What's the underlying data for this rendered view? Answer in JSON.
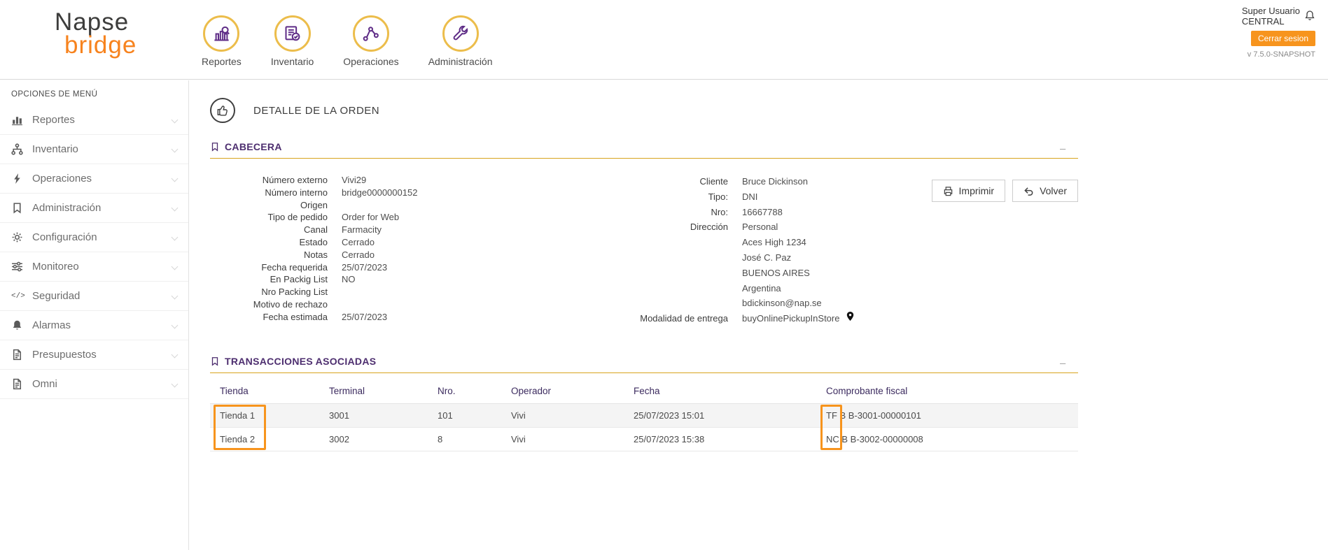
{
  "header": {
    "logo": {
      "line1": "Napse",
      "line2": "bridge"
    },
    "nav": [
      {
        "label": "Reportes",
        "icon": "reports-chart-icon"
      },
      {
        "label": "Inventario",
        "icon": "inventory-clipboard-icon"
      },
      {
        "label": "Operaciones",
        "icon": "operations-network-icon"
      },
      {
        "label": "Administración",
        "icon": "admin-wrench-icon"
      }
    ],
    "user": {
      "name": "Super Usuario",
      "scope": "CENTRAL",
      "logout_label": "Cerrar sesion",
      "version": "v 7.5.0-SNAPSHOT"
    }
  },
  "sidebar": {
    "title": "OPCIONES DE MENÚ",
    "items": [
      {
        "label": "Reportes",
        "icon": "bar-chart-icon"
      },
      {
        "label": "Inventario",
        "icon": "sitemap-icon"
      },
      {
        "label": "Operaciones",
        "icon": "bolt-icon"
      },
      {
        "label": "Administración",
        "icon": "bookmark-icon"
      },
      {
        "label": "Configuración",
        "icon": "gear-icon"
      },
      {
        "label": "Monitoreo",
        "icon": "sliders-icon"
      },
      {
        "label": "Seguridad",
        "icon": "code-icon"
      },
      {
        "label": "Alarmas",
        "icon": "bell-icon"
      },
      {
        "label": "Presupuestos",
        "icon": "document-icon"
      },
      {
        "label": "Omni",
        "icon": "document-icon"
      }
    ]
  },
  "page": {
    "title": "DETALLE DE LA ORDEN"
  },
  "cabecera": {
    "title": "CABECERA",
    "collapse_glyph": "_",
    "fields_left": [
      {
        "label": "Número externo",
        "value": "Vivi29"
      },
      {
        "label": "Número interno",
        "value": "bridge0000000152"
      },
      {
        "label": "Origen",
        "value": ""
      },
      {
        "label": "Tipo de pedido",
        "value": "Order for Web"
      },
      {
        "label": "Canal",
        "value": "Farmacity"
      },
      {
        "label": "Estado",
        "value": "Cerrado"
      },
      {
        "label": "Notas",
        "value": "Cerrado"
      },
      {
        "label": "Fecha requerida",
        "value": "25/07/2023"
      },
      {
        "label": "En Packig List",
        "value": "NO"
      },
      {
        "label": "Nro Packing List",
        "value": ""
      },
      {
        "label": "Motivo de rechazo",
        "value": ""
      },
      {
        "label": "Fecha estimada",
        "value": "25/07/2023"
      }
    ],
    "fields_right": [
      {
        "label": "Cliente",
        "value": "Bruce Dickinson"
      },
      {
        "label": "Tipo:",
        "value": "DNI"
      },
      {
        "label": "Nro:",
        "value": "16667788"
      },
      {
        "label": "Dirección",
        "value": "Personal"
      }
    ],
    "address_lines": [
      "Aces High 1234",
      "José C. Paz",
      "BUENOS AIRES",
      "Argentina",
      "bdickinson@nap.se"
    ],
    "delivery": {
      "label": "Modalidad de entrega",
      "value": "buyOnlinePickupInStore"
    },
    "actions": {
      "print": "Imprimir",
      "back": "Volver"
    }
  },
  "transactions": {
    "title": "TRANSACCIONES ASOCIADAS",
    "collapse_glyph": "_",
    "columns": [
      "Tienda",
      "Terminal",
      "Nro.",
      "Operador",
      "Fecha",
      "Comprobante fiscal"
    ],
    "rows": [
      [
        "Tienda 1",
        "3001",
        "101",
        "Vivi",
        "25/07/2023 15:01",
        "TF B B-3001-00000101"
      ],
      [
        "Tienda 2",
        "3002",
        "8",
        "Vivi",
        "25/07/2023 15:38",
        "NC B B-3002-00000008"
      ]
    ]
  }
}
